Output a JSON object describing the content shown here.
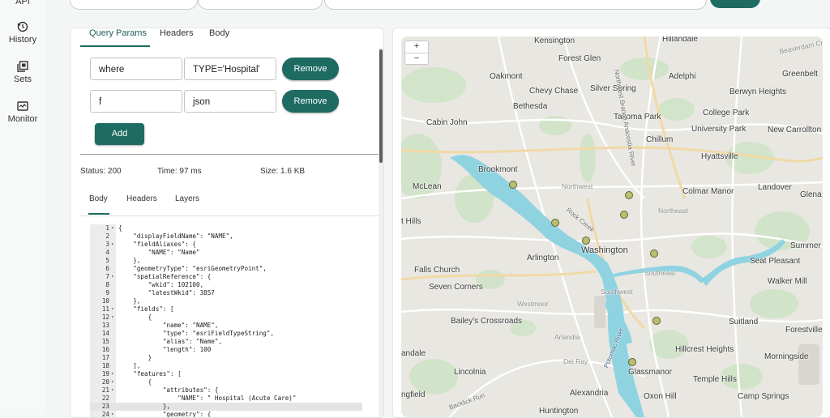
{
  "nav": {
    "items": [
      {
        "label": "API",
        "icon": "api-icon"
      },
      {
        "label": "History",
        "icon": "history-icon"
      },
      {
        "label": "Sets",
        "icon": "sets-icon"
      },
      {
        "label": "Monitor",
        "icon": "monitor-icon"
      }
    ]
  },
  "request": {
    "tabs": [
      "Query Params",
      "Headers",
      "Body"
    ],
    "active_tab": "Query Params",
    "params": [
      {
        "key": "where",
        "value": "TYPE='Hospital'",
        "remove_label": "Remove"
      },
      {
        "key": "f",
        "value": "json",
        "remove_label": "Remove"
      }
    ],
    "add_label": "Add"
  },
  "response": {
    "status": "Status: 200",
    "time": "Time: 97 ms",
    "size": "Size: 1.6 KB",
    "tabs": [
      "Body",
      "Headers",
      "Layers"
    ],
    "active_tab": "Body",
    "code_lines": [
      {
        "n": "1",
        "fold": "▾",
        "text": "{"
      },
      {
        "n": "2",
        "fold": "",
        "text": "    \"displayFieldName\": \"NAME\","
      },
      {
        "n": "3",
        "fold": "▾",
        "text": "    \"fieldAliases\": {"
      },
      {
        "n": "4",
        "fold": "",
        "text": "        \"NAME\": \"Name\""
      },
      {
        "n": "5",
        "fold": "",
        "text": "    },"
      },
      {
        "n": "6",
        "fold": "",
        "text": "    \"geometryType\": \"esriGeometryPoint\","
      },
      {
        "n": "7",
        "fold": "▾",
        "text": "    \"spatialReference\": {"
      },
      {
        "n": "8",
        "fold": "",
        "text": "        \"wkid\": 102100,"
      },
      {
        "n": "9",
        "fold": "",
        "text": "        \"latestWkid\": 3857"
      },
      {
        "n": "10",
        "fold": "",
        "text": "    },"
      },
      {
        "n": "11",
        "fold": "▾",
        "text": "    \"fields\": ["
      },
      {
        "n": "12",
        "fold": "▾",
        "text": "        {"
      },
      {
        "n": "13",
        "fold": "",
        "text": "            \"name\": \"NAME\","
      },
      {
        "n": "14",
        "fold": "",
        "text": "            \"type\": \"esriFieldTypeString\","
      },
      {
        "n": "15",
        "fold": "",
        "text": "            \"alias\": \"Name\","
      },
      {
        "n": "16",
        "fold": "",
        "text": "            \"length\": 100"
      },
      {
        "n": "17",
        "fold": "",
        "text": "        }"
      },
      {
        "n": "18",
        "fold": "",
        "text": "    ],"
      },
      {
        "n": "19",
        "fold": "▾",
        "text": "    \"features\": ["
      },
      {
        "n": "20",
        "fold": "▾",
        "text": "        {"
      },
      {
        "n": "21",
        "fold": "▾",
        "text": "            \"attributes\": {"
      },
      {
        "n": "22",
        "fold": "",
        "text": "                \"NAME\": \" Hospital (Acute Care)\""
      },
      {
        "n": "23",
        "fold": "",
        "text": "            },"
      },
      {
        "n": "24",
        "fold": "▾",
        "text": "            \"geometry\": {"
      }
    ]
  },
  "map": {
    "zoom_in": "+",
    "zoom_out": "−",
    "labels": [
      "Kensington",
      "Hillandale",
      "Beaverdam Cr",
      "Forest Glen",
      "Oakmont",
      "Chevy Chase",
      "Silver Spring",
      "Adelphi",
      "Greenbelt",
      "Berwyn Heights",
      "Bethesda",
      "Takoma Park",
      "College Park",
      "Cabin John",
      "University Park",
      "New Carrollton",
      "Chillum",
      "Hyattsville",
      "Brookmont",
      "McLean",
      "Northwest",
      "Colmar Manor",
      "Landover",
      "Glena",
      "Northeast",
      "Rock Creek",
      "t Hills",
      "Washington",
      "Summer",
      "Falls Church",
      "Arlington",
      "Southeast",
      "Seat Pleasant",
      "Seven Corners",
      "Southwest",
      "Walker Mill",
      "Westmoor",
      "Bailey's Crossroads",
      "Suitland",
      "Forestville",
      "Arlandia",
      "Potomac River",
      "Hillcrest Heights",
      "andale",
      "Morningside",
      "Del Ray",
      "Lincolnia",
      "Glassmanor",
      "Temple Hills",
      "ngfield",
      "Alexandria",
      "Oxon Hill",
      "Camp Springs",
      "Backlick Run",
      "Huntington",
      "Northwest Branch Anacostia River"
    ]
  }
}
